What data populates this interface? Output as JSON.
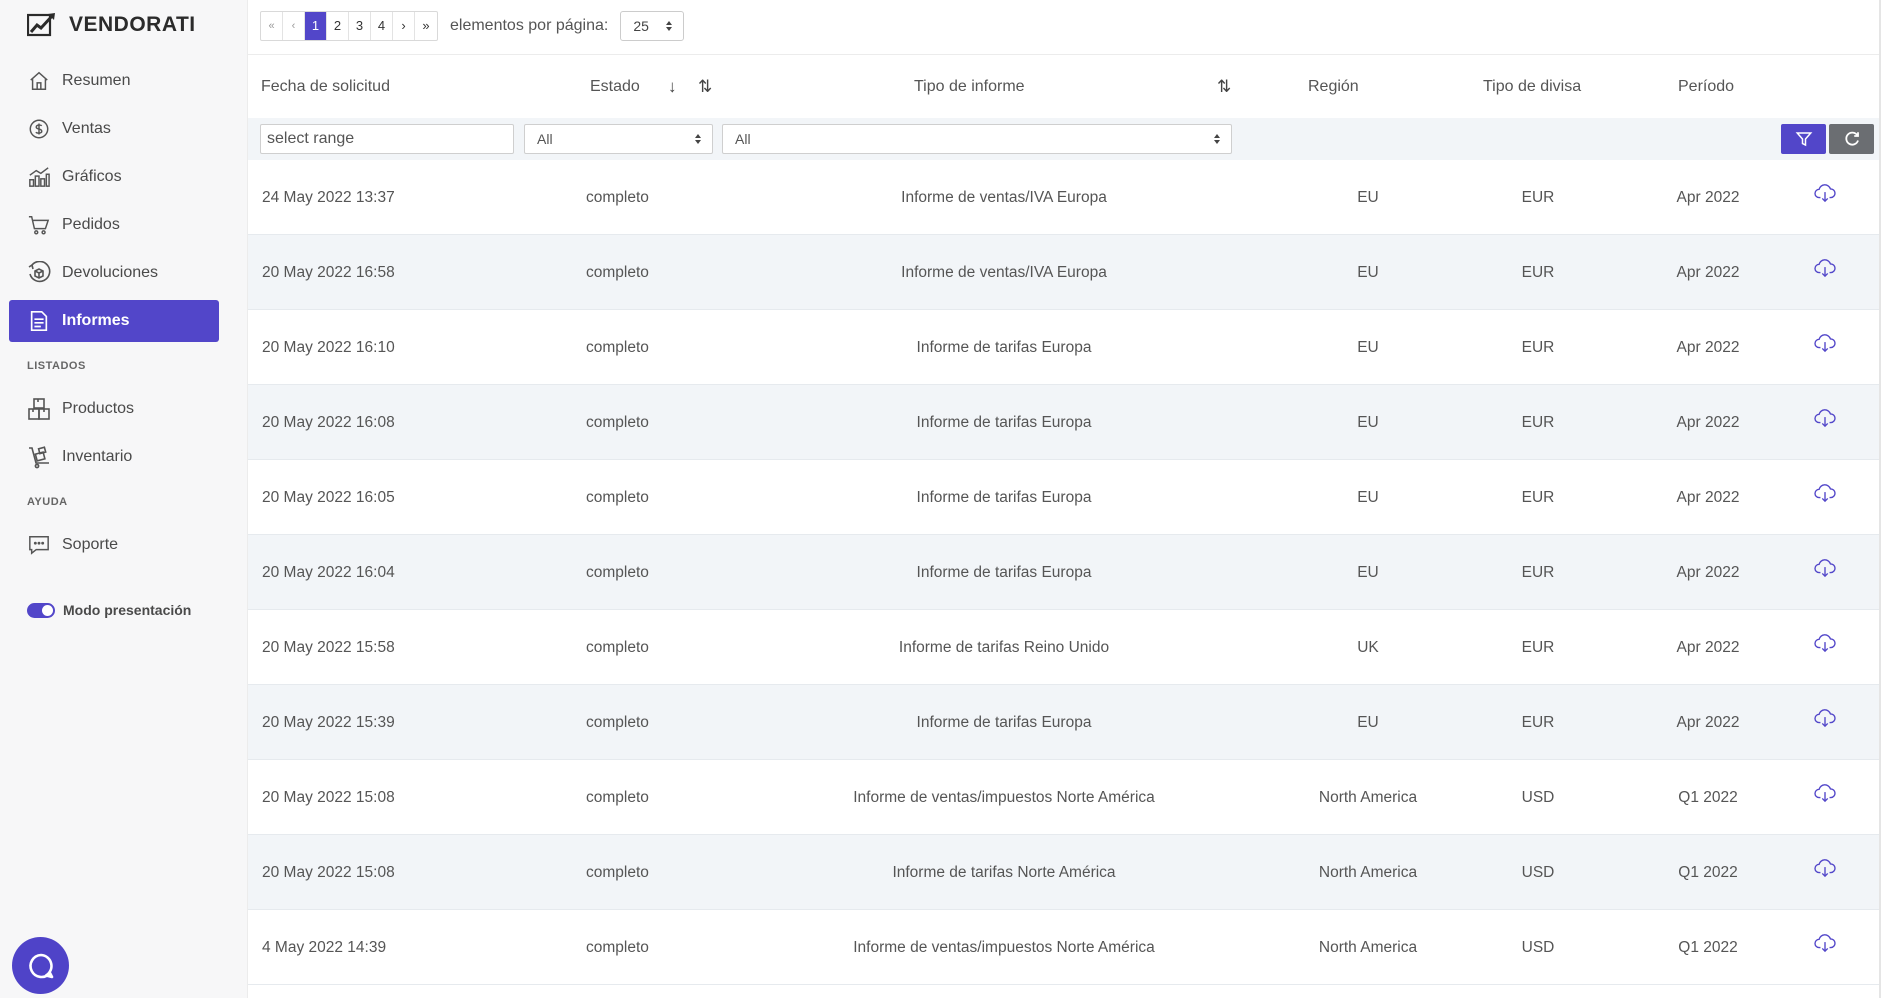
{
  "brand": {
    "name": "VENDORATI"
  },
  "sidebar": {
    "items": [
      {
        "label": "Resumen",
        "icon": "home-icon"
      },
      {
        "label": "Ventas",
        "icon": "dollar-icon"
      },
      {
        "label": "Gráficos",
        "icon": "chart-icon"
      },
      {
        "label": "Pedidos",
        "icon": "cart-icon"
      },
      {
        "label": "Devoluciones",
        "icon": "return-box-icon"
      },
      {
        "label": "Informes",
        "icon": "document-icon",
        "active": true
      }
    ],
    "section_listados": "LISTADOS",
    "listados_items": [
      {
        "label": "Productos",
        "icon": "boxes-icon"
      },
      {
        "label": "Inventario",
        "icon": "dolly-icon"
      }
    ],
    "section_ayuda": "AYUDA",
    "ayuda_items": [
      {
        "label": "Soporte",
        "icon": "chat-bubble-icon"
      }
    ],
    "presentation_mode": {
      "label": "Modo presentación",
      "enabled": true
    }
  },
  "pagination": {
    "first": "«",
    "prev": "‹",
    "next": "›",
    "last": "»",
    "pages": [
      "1",
      "2",
      "3",
      "4"
    ],
    "active_page": "1",
    "per_page_label": "elementos por página:",
    "per_page_value": "25"
  },
  "table": {
    "headers": {
      "date": "Fecha de solicitud",
      "date_sort": "↓",
      "status": "Estado",
      "status_sort": "⇅",
      "type": "Tipo de informe",
      "type_sort": "⇅",
      "region": "Región",
      "currency": "Tipo de divisa",
      "period": "Período"
    },
    "filters": {
      "date_placeholder": "select range",
      "status_value": "All",
      "type_value": "All"
    },
    "rows": [
      {
        "date": "24 May 2022 13:37",
        "status": "completo",
        "type": "Informe de ventas/IVA Europa",
        "region": "EU",
        "currency": "EUR",
        "period": "Apr 2022"
      },
      {
        "date": "20 May 2022 16:58",
        "status": "completo",
        "type": "Informe de ventas/IVA Europa",
        "region": "EU",
        "currency": "EUR",
        "period": "Apr 2022"
      },
      {
        "date": "20 May 2022 16:10",
        "status": "completo",
        "type": "Informe de tarifas Europa",
        "region": "EU",
        "currency": "EUR",
        "period": "Apr 2022"
      },
      {
        "date": "20 May 2022 16:08",
        "status": "completo",
        "type": "Informe de tarifas Europa",
        "region": "EU",
        "currency": "EUR",
        "period": "Apr 2022"
      },
      {
        "date": "20 May 2022 16:05",
        "status": "completo",
        "type": "Informe de tarifas Europa",
        "region": "EU",
        "currency": "EUR",
        "period": "Apr 2022"
      },
      {
        "date": "20 May 2022 16:04",
        "status": "completo",
        "type": "Informe de tarifas Europa",
        "region": "EU",
        "currency": "EUR",
        "period": "Apr 2022"
      },
      {
        "date": "20 May 2022 15:58",
        "status": "completo",
        "type": "Informe de tarifas Reino Unido",
        "region": "UK",
        "currency": "EUR",
        "period": "Apr 2022"
      },
      {
        "date": "20 May 2022 15:39",
        "status": "completo",
        "type": "Informe de tarifas Europa",
        "region": "EU",
        "currency": "EUR",
        "period": "Apr 2022"
      },
      {
        "date": "20 May 2022 15:08",
        "status": "completo",
        "type": "Informe de ventas/impuestos Norte América",
        "region": "North America",
        "currency": "USD",
        "period": "Q1 2022"
      },
      {
        "date": "20 May 2022 15:08",
        "status": "completo",
        "type": "Informe de tarifas Norte América",
        "region": "North America",
        "currency": "USD",
        "period": "Q1 2022"
      },
      {
        "date": "4 May 2022 14:39",
        "status": "completo",
        "type": "Informe de ventas/impuestos Norte América",
        "region": "North America",
        "currency": "USD",
        "period": "Q1 2022"
      }
    ]
  },
  "colors": {
    "accent": "#5246c9",
    "row_alt": "#f2f5f8",
    "sidebar_bg": "#f7f7f8"
  }
}
